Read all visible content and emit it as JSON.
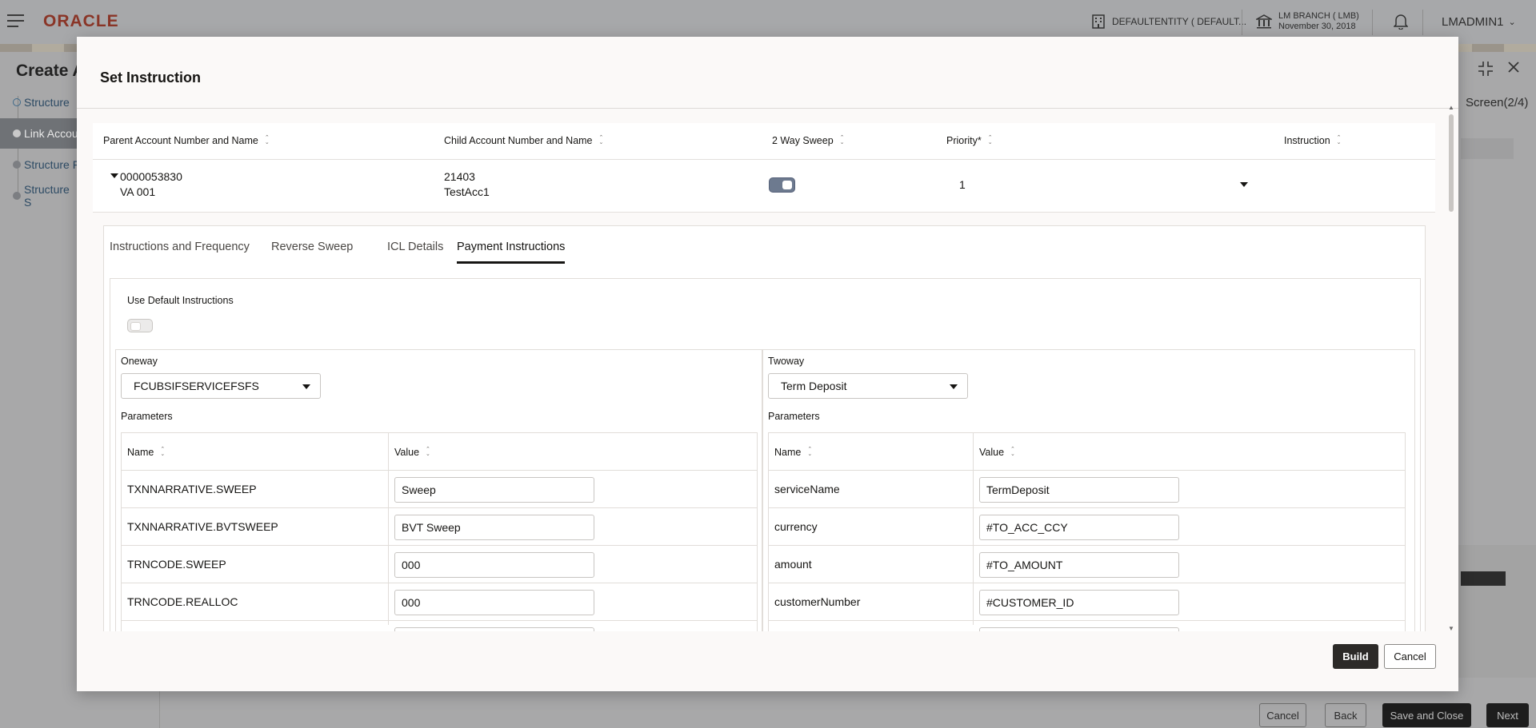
{
  "topbar": {
    "logo": "ORACLE",
    "entity": "DEFAULTENTITY ( DEFAULT...",
    "branch_name": "LM BRANCH ( LMB)",
    "branch_date": "November 30, 2018",
    "user": "LMADMIN1"
  },
  "background": {
    "title": "Create A",
    "nav": [
      "Structure",
      "Link Accou",
      "Structure F",
      "Structure S"
    ],
    "screen_indicator": "Screen(2/4)",
    "footer_buttons": [
      "Cancel",
      "Back",
      "Save and Close",
      "Next"
    ]
  },
  "modal": {
    "title": "Set Instruction",
    "grid": {
      "headers": [
        "Parent Account Number and Name",
        "Child Account Number and Name",
        "2 Way Sweep",
        "Priority*",
        "Instruction"
      ],
      "row": {
        "parent_number": "0000053830",
        "parent_name": "VA 001",
        "child_number": "21403",
        "child_name": "TestAcc1",
        "two_way_sweep": true,
        "priority": "1"
      }
    },
    "tabs": [
      "Instructions and Frequency",
      "Reverse Sweep",
      "ICL Details",
      "Payment Instructions"
    ],
    "active_tab": "Payment Instructions",
    "use_default_label": "Use Default Instructions",
    "use_default_value": false,
    "oneway": {
      "label": "Oneway",
      "selected": "FCUBSIFSERVICEFSFS",
      "parameters_label": "Parameters",
      "headers": [
        "Name",
        "Value"
      ],
      "rows": [
        {
          "name": "TXNNARRATIVE.SWEEP",
          "value": "Sweep"
        },
        {
          "name": "TXNNARRATIVE.BVTSWEEP",
          "value": "BVT Sweep"
        },
        {
          "name": "TRNCODE.SWEEP",
          "value": "000"
        },
        {
          "name": "TRNCODE.REALLOC",
          "value": "000"
        }
      ]
    },
    "twoway": {
      "label": "Twoway",
      "selected": "Term Deposit",
      "parameters_label": "Parameters",
      "headers": [
        "Name",
        "Value"
      ],
      "rows": [
        {
          "name": "serviceName",
          "value": "TermDeposit"
        },
        {
          "name": "currency",
          "value": "#TO_ACC_CCY"
        },
        {
          "name": "amount",
          "value": "#TO_AMOUNT"
        },
        {
          "name": "customerNumber",
          "value": "#CUSTOMER_ID"
        }
      ]
    },
    "footer": {
      "build": "Build",
      "cancel": "Cancel"
    }
  }
}
